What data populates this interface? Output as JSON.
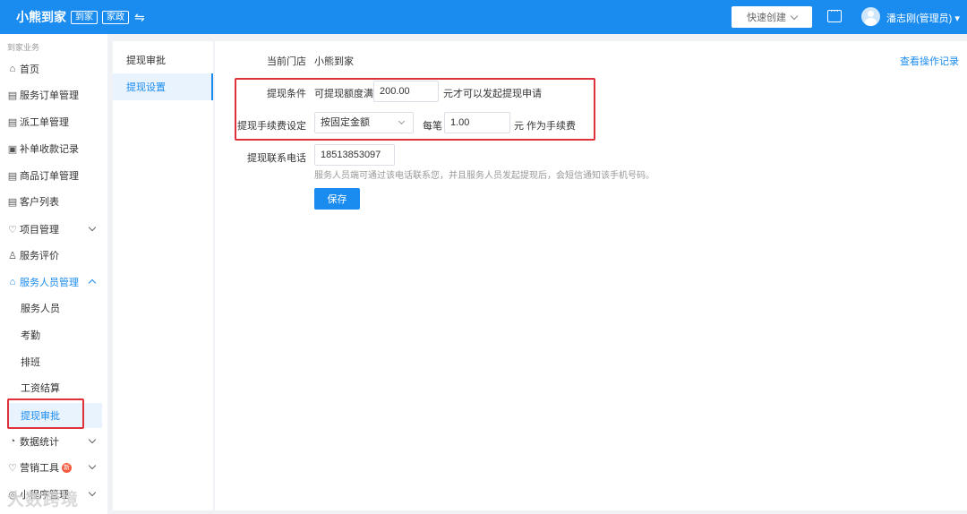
{
  "header": {
    "brand": "小熊到家",
    "tags": [
      "到家",
      "家政"
    ],
    "switch_icon": "⇋",
    "quick_create": "快速创建",
    "username": "潘志刚(管理员) ▾"
  },
  "sidebar": {
    "section_title": "到家业务",
    "items": [
      {
        "icon": "home-icon",
        "glyph": "⌂",
        "label": "首页"
      },
      {
        "icon": "clipboard-icon",
        "glyph": "▤",
        "label": "服务订单管理"
      },
      {
        "icon": "dispatch-icon",
        "glyph": "▤",
        "label": "派工单管理"
      },
      {
        "icon": "receipt-icon",
        "glyph": "▣",
        "label": "补单收款记录"
      },
      {
        "icon": "order-icon",
        "glyph": "▤",
        "label": "商品订单管理"
      },
      {
        "icon": "customer-icon",
        "glyph": "▤",
        "label": "客户列表"
      },
      {
        "icon": "heart-icon",
        "glyph": "♡",
        "label": "项目管理"
      },
      {
        "icon": "rating-icon",
        "glyph": "♙",
        "label": "服务评价"
      },
      {
        "icon": "lock-icon",
        "glyph": "⌂",
        "label": "服务人员管理"
      }
    ],
    "sub_items": [
      "服务人员",
      "考勤",
      "排班",
      "工资结算",
      "提现审批"
    ],
    "bottom_items": [
      {
        "icon": "chart-icon",
        "glyph": "◔",
        "label": "数据统计"
      },
      {
        "icon": "marketing-icon",
        "glyph": "♡",
        "label": "营销工具",
        "badge": "新"
      },
      {
        "icon": "miniapp-icon",
        "glyph": "◎",
        "label": "小程序管理"
      }
    ],
    "watermark": "大数跨境"
  },
  "subnav": {
    "items": [
      "提现审批",
      "提现设置"
    ]
  },
  "main": {
    "op_link": "查看操作记录",
    "store_label": "当前门店",
    "store_value": "小熊到家",
    "condition_label": "提现条件",
    "condition_prefix": "可提现额度满",
    "condition_value": "200.00",
    "condition_suffix": "元才可以发起提现申请",
    "fee_label": "提现手续费设定",
    "fee_mode": "按固定金额",
    "fee_per": "每笔",
    "fee_value": "1.00",
    "fee_suffix": "元 作为手续费",
    "phone_label": "提现联系电话",
    "phone_value": "18513853097",
    "phone_hint": "服务人员端可通过该电话联系您，并且服务人员发起提现后，会短信通知该手机号码。",
    "save": "保存"
  },
  "colors": {
    "primary": "#1a8cf0",
    "highlight_box": "#e0313b"
  }
}
